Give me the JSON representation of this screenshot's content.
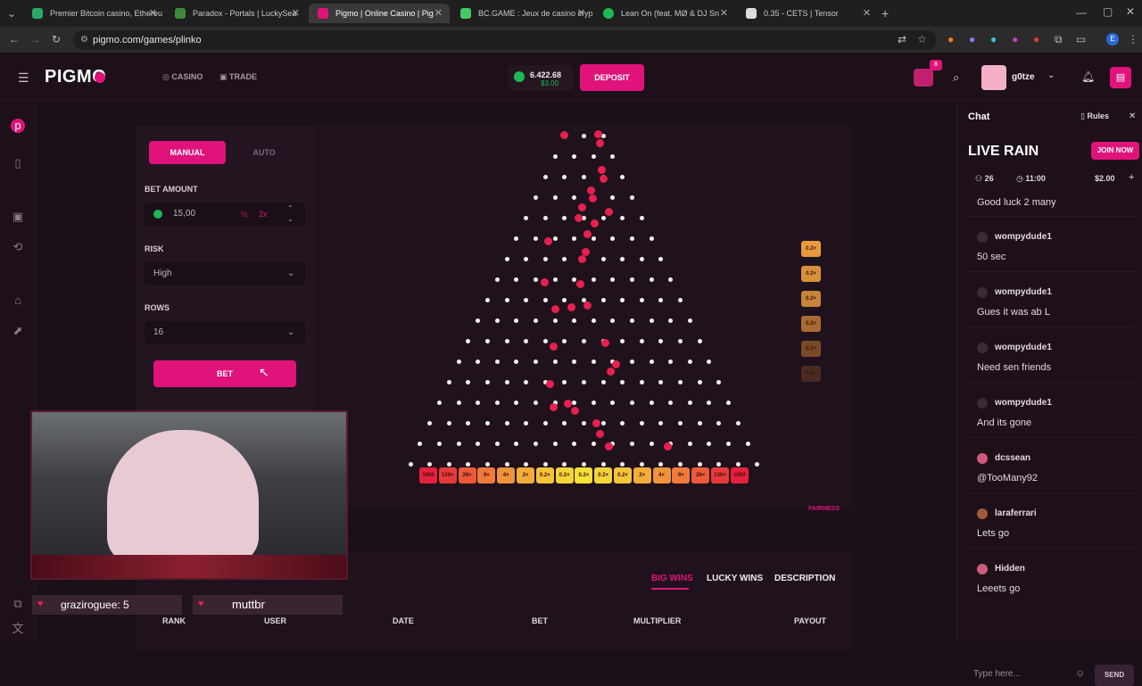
{
  "browser": {
    "tabs": [
      {
        "label": "Premier Bitcoin casino, Ethereu",
        "color": "#2aa86a"
      },
      {
        "label": "Paradox - Portals | LuckySea",
        "color": "#3f8a3a"
      },
      {
        "label": "Pigmo | Online Casino | Pig",
        "color": "#e0137a"
      },
      {
        "label": "BC.GAME : Jeux de casino cryp",
        "color": "#46c86a"
      },
      {
        "label": "Lean On (feat. MØ & DJ Sn",
        "color": "#1db954"
      },
      {
        "label": "0.35 - CETS | Tensor",
        "color": "#dddddd"
      }
    ],
    "url": "pigmo.com/games/plinko"
  },
  "nav": {
    "logo": "PIGMO",
    "casino": "CASINO",
    "trade": "TRADE",
    "balance": "6.422.68",
    "balance_sub": "$3.00",
    "deposit": "DEPOSIT",
    "badge": "8",
    "username": "g0tze"
  },
  "bet": {
    "mode_manual": "MANUAL",
    "mode_auto": "AUTO",
    "bet_amount_label": "BET AMOUNT",
    "bet_amount": "15,00",
    "half": "½",
    "double": "2x",
    "risk_label": "RISK",
    "risk": "High",
    "rows_label": "ROWS",
    "rows": "16",
    "bet_button": "BET"
  },
  "plinko": {
    "buckets": [
      "1000",
      "130×",
      "26×",
      "9×",
      "4×",
      "2×",
      "0.2×",
      "0.2×",
      "0.2×",
      "0.2×",
      "0.2×",
      "2×",
      "4×",
      "9×",
      "26×",
      "130×",
      "1000"
    ],
    "history": [
      "0.2×",
      "0.2×",
      "0.2×",
      "0.2×",
      "0.2×",
      "0.2×"
    ],
    "fairness": "FAIRNESS"
  },
  "bets_table": {
    "tabs": [
      "BIG WINS",
      "LUCKY WINS",
      "DESCRIPTION"
    ],
    "columns": [
      "RANK",
      "USER",
      "DATE",
      "BET",
      "MULTIPLIER",
      "PAYOUT"
    ]
  },
  "webcam": {
    "tag1": "graziroguee: 5",
    "tag2": "muttbr"
  },
  "chat": {
    "title": "Chat",
    "rules": "Rules",
    "live_rain": "LIVE RAIN",
    "join": "JOIN NOW",
    "participants": "26",
    "timer": "11:00",
    "amount": "$2.00",
    "first_message": "Good luck 2 many",
    "messages": [
      {
        "user": "wompydude1",
        "text": "50 sec"
      },
      {
        "user": "wompydude1",
        "text": "Gues it was ab L"
      },
      {
        "user": "wompydude1",
        "text": "Need sen friends"
      },
      {
        "user": "wompydude1",
        "text": "And its gone"
      },
      {
        "user": "dcssean",
        "text": "@TooMany92"
      },
      {
        "user": "laraferrari",
        "text": "Lets go"
      },
      {
        "user": "Hidden",
        "text": "Leeets go"
      }
    ],
    "input_placeholder": "Type here...",
    "send": "SEND"
  },
  "colors": {
    "accent": "#e0137a",
    "background": "#1b0f18",
    "panel": "#1f121c"
  }
}
